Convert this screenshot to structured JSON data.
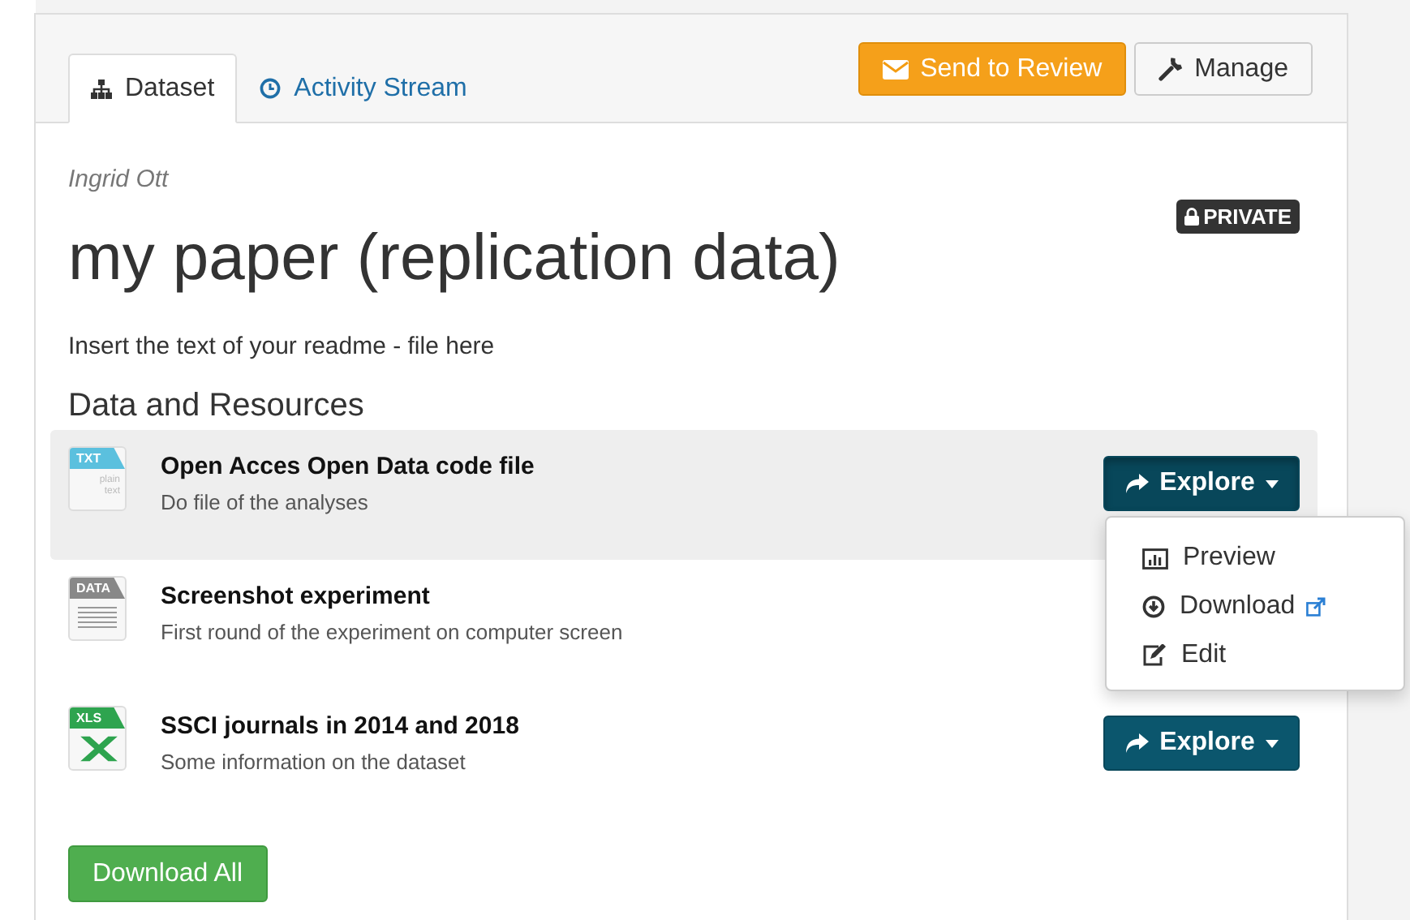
{
  "tabs": [
    {
      "label": "Dataset",
      "selected": true
    },
    {
      "label": "Activity Stream",
      "selected": false
    }
  ],
  "actions": [
    {
      "label": "Send to Review",
      "kind": "primary"
    },
    {
      "label": "Manage",
      "kind": "default"
    }
  ],
  "author": "Ingrid Ott",
  "badge": "PRIVATE",
  "title": "my paper (replication data)",
  "readme": "Insert the text of your readme - file here",
  "section_title": "Data and Resources",
  "resources": [
    {
      "format": "TXT",
      "format_note": "plain text",
      "name": "Open Acces Open Data code file",
      "description": "Do file of the analyses",
      "selected": true,
      "explore": {
        "label": "Explore",
        "expanded": true,
        "menu": [
          {
            "label": "Preview",
            "external": false
          },
          {
            "label": "Download",
            "external": true
          },
          {
            "label": "Edit",
            "external": false
          }
        ]
      }
    },
    {
      "format": "DATA",
      "name": "Screenshot experiment",
      "description": "First round of the experiment on computer screen",
      "selected": false
    },
    {
      "format": "XLS",
      "name": "SSCI journals in 2014 and 2018",
      "description": "Some information on the dataset",
      "selected": false,
      "explore": {
        "label": "Explore",
        "expanded": false
      }
    }
  ],
  "download_all": "Download All"
}
